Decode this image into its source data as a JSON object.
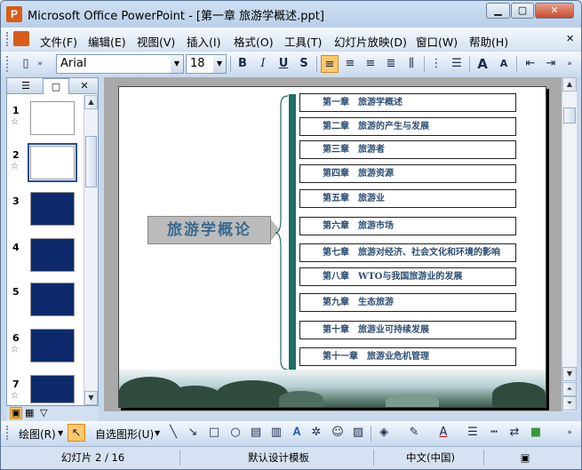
{
  "window": {
    "app_icon": "P",
    "title": "Microsoft Office PowerPoint - [第一章 旅游学概述.ppt]",
    "min_icon": "minimize-icon",
    "max_icon": "maximize-icon",
    "close_label": "✕"
  },
  "menubar": {
    "items": [
      "文件(F)",
      "编辑(E)",
      "视图(V)",
      "插入(I)",
      "格式(O)",
      "工具(T)",
      "幻灯片放映(D)",
      "窗口(W)",
      "帮助(H)"
    ],
    "close_label": "✕"
  },
  "toolbar": {
    "font_name": "Arial",
    "font_size": "18",
    "bold": "B",
    "italic": "I",
    "underline": "U",
    "shadow": "S",
    "grow_font": "A",
    "shrink_font": "A"
  },
  "slides_pane": {
    "tab_outline_icon": "outline-tab-icon",
    "tab_slides_icon": "slides-tab-icon",
    "close_label": "✕",
    "thumbnails": [
      {
        "number": "1",
        "star": "☆"
      },
      {
        "number": "2",
        "star": "☆"
      },
      {
        "number": "3",
        "star": ""
      },
      {
        "number": "4",
        "star": ""
      },
      {
        "number": "5",
        "star": ""
      },
      {
        "number": "6",
        "star": "☆"
      },
      {
        "number": "7",
        "star": "☆"
      }
    ],
    "selected_index": 1
  },
  "slide": {
    "main_title": "旅游学概论",
    "chapters": [
      "第一章　旅游学概述",
      "第二章　旅游的产生与发展",
      "第三章　旅游者",
      "第四章　旅游资源",
      "第五章　旅游业",
      "第六章　旅游市场",
      "第七章　旅游对经济、社会文化和环境的影响",
      "第八章　WTO与我国旅游业的发展",
      "第九章　生态旅游",
      "第十章　旅游业可持续发展",
      "第十一章　旅游业危机管理"
    ]
  },
  "drawing_toolbar": {
    "draw_label": "绘图(R)",
    "autoshape_label": "自选图形(U)"
  },
  "status": {
    "slide_indicator": "幻灯片 2 / 16",
    "design_template": "默认设计模板",
    "language": "中文(中国)"
  },
  "colors": {
    "accent_teal": "#1f6e66",
    "chapter_text": "#2d4e74",
    "title_text": "#3a6a8f",
    "active_button": "#ffc86b"
  }
}
